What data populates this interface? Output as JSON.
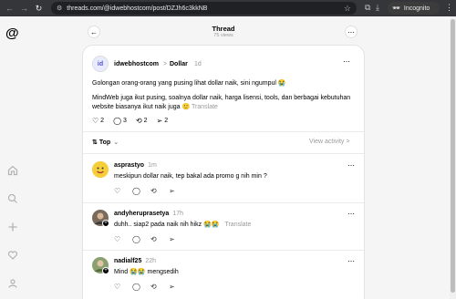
{
  "browser": {
    "url": "threads.com/@idwebhostcom/post/DZJh6c3kkNB",
    "incognito_label": "Incognito"
  },
  "header": {
    "title": "Thread",
    "views": "75 views"
  },
  "post": {
    "author": "idwebhostcom",
    "separator": ">",
    "topic": "Dollar",
    "time": "1d",
    "text1": "Golongan orang-orang yang pusing lihat dollar naik, sini ngumpul 😭",
    "text2": "MindWeb juga ikut pusing, soalnya dollar naik, harga lisensi, tools, dan berbagai kebutuhan website biasanya ikut naik juga 🙂",
    "translate": "Translate",
    "likes": "2",
    "comments": "3",
    "reposts": "2",
    "shares": "2"
  },
  "sort": {
    "label": "Top",
    "view_activity": "View activity >"
  },
  "replies": [
    {
      "author": "asprastyo",
      "time": "1m",
      "text": "meskipun dollar naik, tep bakal ada promo g nih min ?",
      "translate": ""
    },
    {
      "author": "andyheruprasetya",
      "time": "17h",
      "text": "duhh.. siap2 pada naik nih hikz 😭😭",
      "translate": "Translate"
    },
    {
      "author": "nadialf25",
      "time": "22h",
      "text": "Mind 😭😭 mengsedih",
      "translate": ""
    }
  ],
  "colors": {
    "chrome_bg": "#35363a",
    "omnibox_bg": "#202124",
    "page_bg": "#f5f5f5",
    "card_bg": "#ffffff",
    "muted_text": "#999999"
  }
}
